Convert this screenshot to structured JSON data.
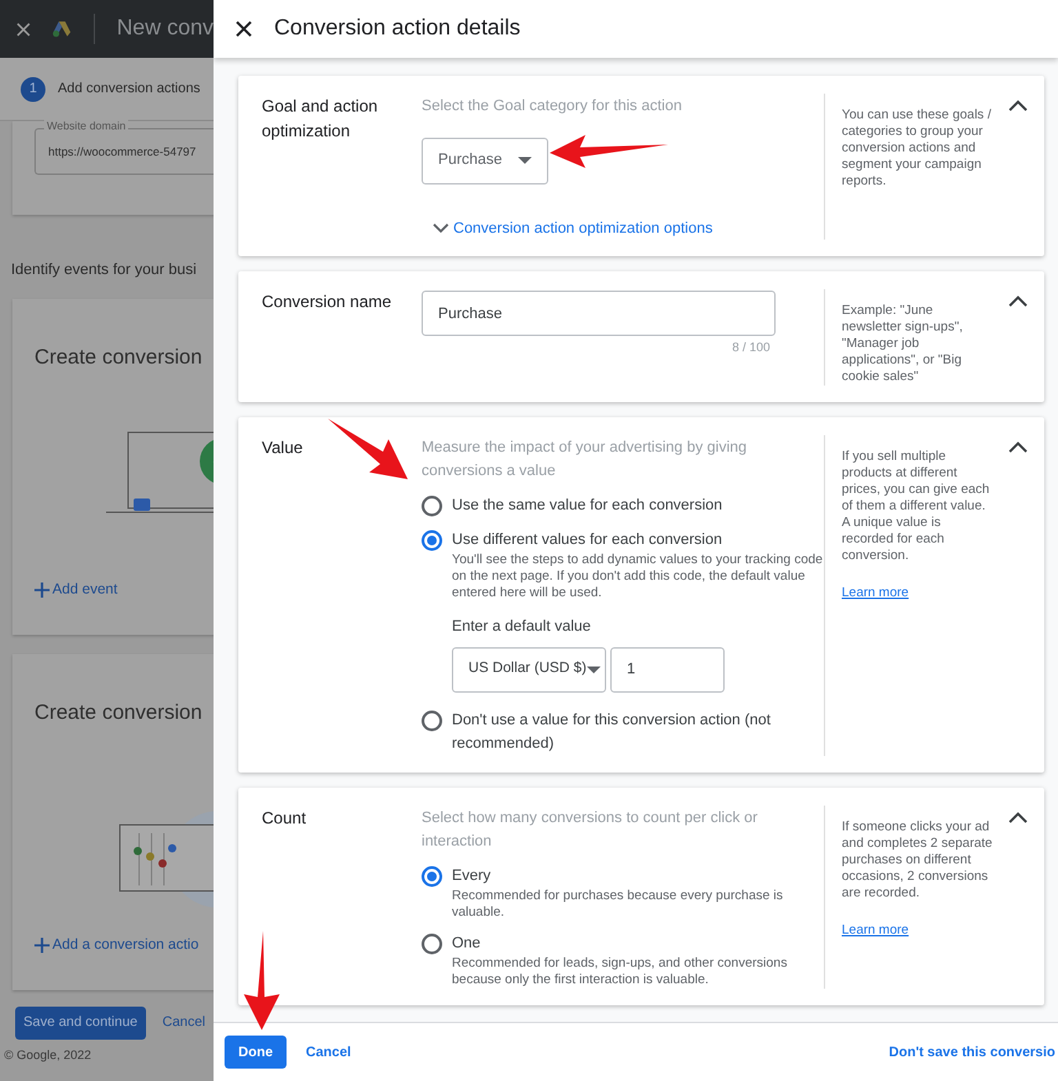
{
  "background": {
    "app_title": "New conv",
    "step": {
      "number": "1",
      "label": "Add conversion actions"
    },
    "domain_field": {
      "label": "Website domain",
      "value": "https://woocommerce-54797"
    },
    "heading": "Identify events for your busi",
    "cards": [
      {
        "kind": "monitor",
        "title": "Create conversion",
        "action": "Add event"
      },
      {
        "kind": "chart",
        "title": "Create conversion",
        "action": "Add a conversion actio"
      }
    ],
    "save_button": "Save and continue",
    "cancel": "Cancel",
    "copyright": "© Google, 2022"
  },
  "panel": {
    "title": "Conversion action details",
    "sections": [
      {
        "kind": "goal",
        "label": "Goal and action optimization",
        "expanded": true,
        "hint": "Select the Goal category for this action",
        "select": "Purchase",
        "link": "Conversion action optimization options",
        "help": "You can use these goals / categories to group your conversion actions and segment your campaign reports."
      },
      {
        "kind": "name",
        "label": "Conversion name",
        "expanded": true,
        "value": "Purchase",
        "counter": "8 / 100",
        "help": "Example: \"June newsletter sign-ups\", \"Manager job applications\", or \"Big cookie sales\""
      },
      {
        "kind": "radios",
        "label": "Value",
        "expanded": true,
        "hint": "Measure the impact of your advertising by giving conversions a value",
        "options": [
          {
            "label": "Use the same value for each conversion",
            "selected": false
          },
          {
            "label": "Use different values for each conversion",
            "selected": true,
            "description": "You'll see the steps to add dynamic values to your tracking code on the next page. If you don't add this code, the default value entered here will be used.",
            "default_value": {
              "label": "Enter a default value",
              "currency": "US Dollar (USD $)",
              "amount": "1"
            }
          },
          {
            "label": "Don't use a value for this conversion action (not recommended)",
            "selected": false
          }
        ],
        "help": "If you sell multiple products at different prices, you can give each of them a different value. A unique value is recorded for each conversion.",
        "learn_more": "Learn more"
      },
      {
        "kind": "radios",
        "label": "Count",
        "expanded": true,
        "hint": "Select how many conversions to count per click or interaction",
        "options": [
          {
            "label": "Every",
            "selected": true,
            "description": "Recommended for purchases because every purchase is valuable."
          },
          {
            "label": "One",
            "selected": false,
            "description": "Recommended for leads, sign-ups, and other conversions because only the first interaction is valuable."
          }
        ],
        "help": "If someone clicks your ad and completes 2 separate purchases on different occasions, 2 conversions are recorded.",
        "learn_more": "Learn more"
      }
    ],
    "footer": {
      "done": "Done",
      "cancel": "Cancel",
      "dont_save": "Don't save this conversio"
    }
  }
}
